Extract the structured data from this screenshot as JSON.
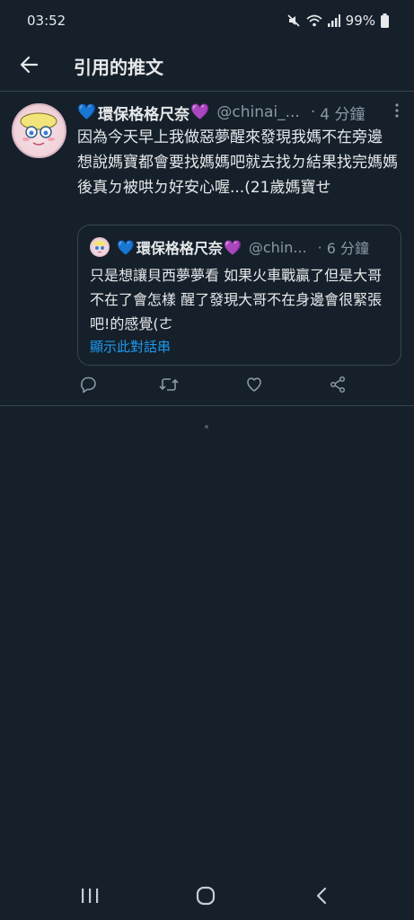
{
  "status_bar": {
    "time": "03:52",
    "battery_text": "99%",
    "icons": [
      "mute-icon",
      "wifi-icon",
      "signal-icon",
      "battery-icon"
    ]
  },
  "header": {
    "title": "引用的推文",
    "back_icon": "arrow-left-icon"
  },
  "tweet": {
    "heart_left": "💙",
    "display_name": "環保格格尺奈",
    "heart_right": "💜",
    "handle": "@chinai_...",
    "dot": "·",
    "time_ago": "4 分鐘",
    "text": "因為今天早上我做惡夢醒來發現我媽不在旁邊 想說媽寶都會要找媽媽吧就去找ㄉ結果找完媽媽後真ㄉ被哄ㄉ好安心喔...(21歲媽寶せ",
    "quoted": {
      "heart_left": "💙",
      "display_name": "環保格格尺奈",
      "heart_right": "💜",
      "handle": "@chin...",
      "dot": "·",
      "time_ago": "6 分鐘",
      "text": "只是想讓貝西夢夢看 如果火車戰贏了但是大哥不在了會怎樣 醒了發現大哥不在身邊會很緊張吧!的感覺(ㄜ",
      "show_thread": "顯示此對話串"
    }
  },
  "colors": {
    "background": "#15202b",
    "divider": "#38444d",
    "secondary_text": "#8b98a5",
    "link": "#1d9bf0"
  }
}
